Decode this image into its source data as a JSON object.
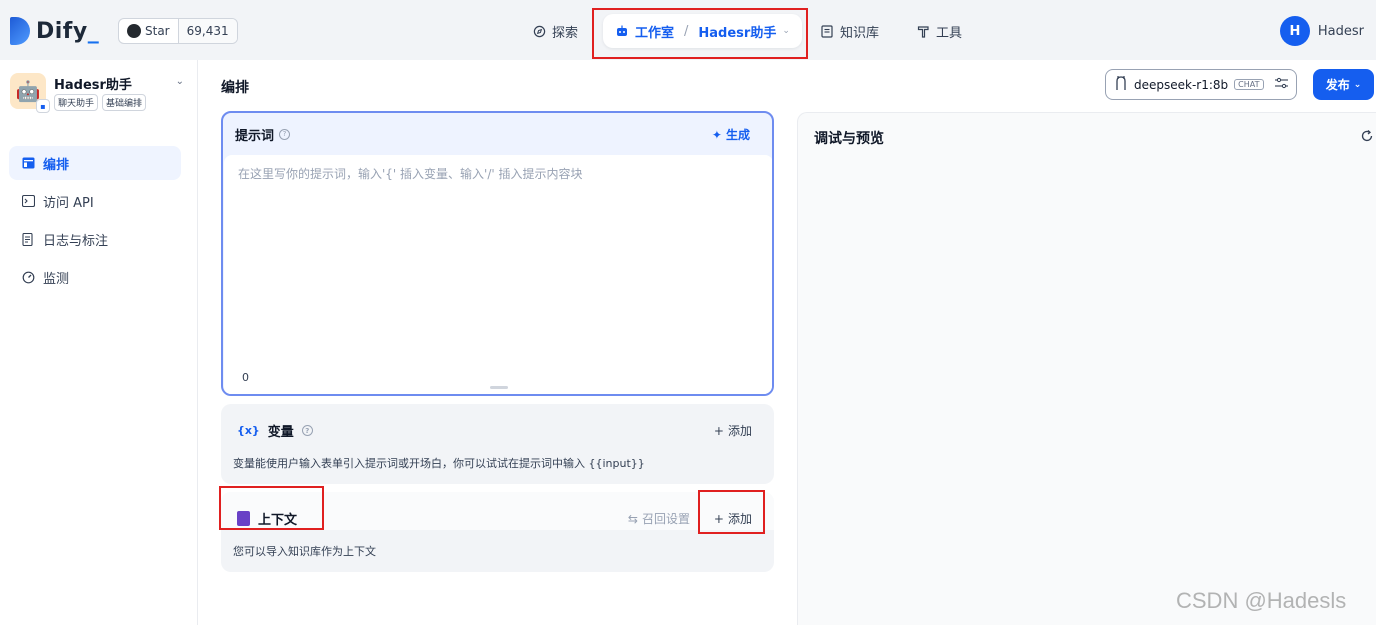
{
  "brand": {
    "name": "Dify",
    "underscore": "_"
  },
  "github": {
    "star_label": "Star",
    "count": "69,431"
  },
  "nav": {
    "explore": "探索",
    "studio": "工作室",
    "studio_sep": "/",
    "app_crumb": "Hadesr助手",
    "knowledge": "知识库",
    "tools": "工具"
  },
  "user": {
    "initial": "H",
    "name": "Hadesr"
  },
  "app": {
    "name": "Hadesr助手",
    "tags": [
      "聊天助手",
      "基础编排"
    ]
  },
  "sidebar": {
    "items": [
      {
        "label": "编排",
        "icon": "layout-icon",
        "active": true
      },
      {
        "label": "访问 API",
        "icon": "terminal-icon",
        "active": false
      },
      {
        "label": "日志与标注",
        "icon": "file-list-icon",
        "active": false
      },
      {
        "label": "监测",
        "icon": "gauge-icon",
        "active": false
      }
    ]
  },
  "main": {
    "title": "编排",
    "model": {
      "name": "deepseek-r1:8b",
      "mode": "CHAT"
    },
    "publish_label": "发布"
  },
  "prompt": {
    "title": "提示词",
    "generate_label": "生成",
    "placeholder": "在这里写你的提示词，输入'{' 插入变量、输入'/' 插入提示内容块",
    "char_count": "0"
  },
  "variables": {
    "icon_text": "{x}",
    "title": "变量",
    "add_label": "添加",
    "description": "变量能使用户输入表单引入提示词或开场白，你可以试试在提示词中输入 {{input}}"
  },
  "context": {
    "title": "上下文",
    "recall_label": "召回设置",
    "add_label": "添加",
    "description": "您可以导入知识库作为上下文"
  },
  "debug": {
    "title": "调试与预览"
  },
  "watermark": "CSDN @Hadesls"
}
